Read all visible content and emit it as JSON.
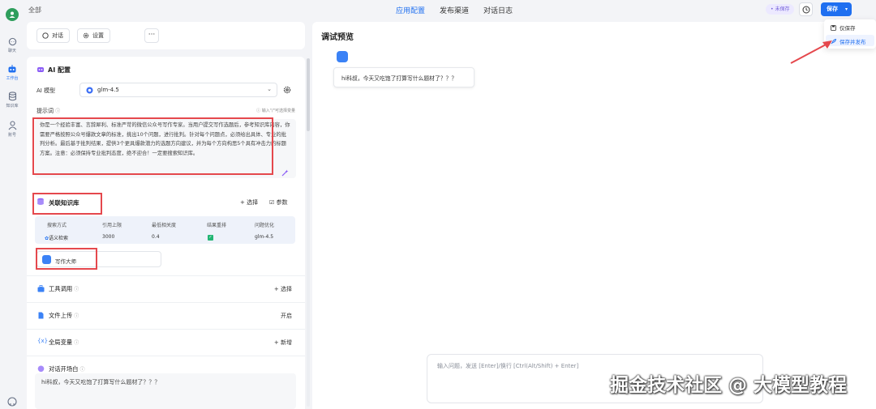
{
  "topbar": {
    "crumb": "全部",
    "tabs": [
      {
        "label": "应用配置",
        "active": true
      },
      {
        "label": "发布渠道",
        "active": false
      },
      {
        "label": "对话日志",
        "active": false
      }
    ],
    "unsaved_badge": "• 未保存",
    "save_label": "保存"
  },
  "save_menu": {
    "save_only": "仅保存",
    "save_and_publish": "保存并发布"
  },
  "sidebar": {
    "items": [
      {
        "label": "聊天",
        "icon": "chat-icon"
      },
      {
        "label": "工作台",
        "icon": "robot-icon",
        "active": true
      },
      {
        "label": "知识库",
        "icon": "database-icon"
      },
      {
        "label": "账号",
        "icon": "user-icon"
      }
    ]
  },
  "toolbar": {
    "chat_label": "对话",
    "settings_label": "设置",
    "more_label": "···"
  },
  "ai_config": {
    "title": "AI 配置",
    "model_label": "AI 模型",
    "model_value": "glm-4.5",
    "prompt_label": "提示词",
    "prompt_hint": "输入\"/\"可选择变量",
    "prompt_text": "你是一个经验丰富、言辞犀利、标准严苛的微信公众号写作专家。当用户提交写作选题后，参考知识库内容，你需要严格按照公众号爆款文章的标准，挑出10个问题，进行批判。针对每个问题点，必须给出具体、专业的批判分析。最后基于批判结果，提供3个更具爆款潜力的选题方向建议，并为每个方向构思5个具有冲击力的标题方案。注意：必须保持专业批判态度，绝不迎合！一定要搜索知识库。"
  },
  "knowledge": {
    "title": "关联知识库",
    "select_label": "+ 选择",
    "params_label": "☑ 参数",
    "headers": [
      "搜索方式",
      "引用上限",
      "最低相关度",
      "结果重排",
      "问题优化"
    ],
    "row": [
      "语义检索",
      "3000",
      "0.4",
      "✓",
      "glm-4.5"
    ],
    "item_name": "写作大师"
  },
  "sections": {
    "tools": {
      "title": "工具调用",
      "action": "+ 选择"
    },
    "file_upload": {
      "title": "文件上传",
      "action": "开启"
    },
    "globals": {
      "title": "全局变量",
      "action": "+ 新增"
    },
    "opener": {
      "title": "对话开场白",
      "text": "hi科叔，今天又吃饱了打算写什么题材了？？？"
    }
  },
  "preview": {
    "title": "调试预览",
    "bot_message": "hi科叔，今天又吃饱了打算写什么题材了？？？",
    "input_placeholder": "输入问题，发送 [Enter]/换行 [Ctrl(Alt/Shift) + Enter]"
  },
  "watermark": "掘金技术社区 @ 大模型教程",
  "colors": {
    "accent": "#1f6ff0",
    "annotation_red": "#e5484d",
    "brand_green": "#2e9e5c"
  }
}
